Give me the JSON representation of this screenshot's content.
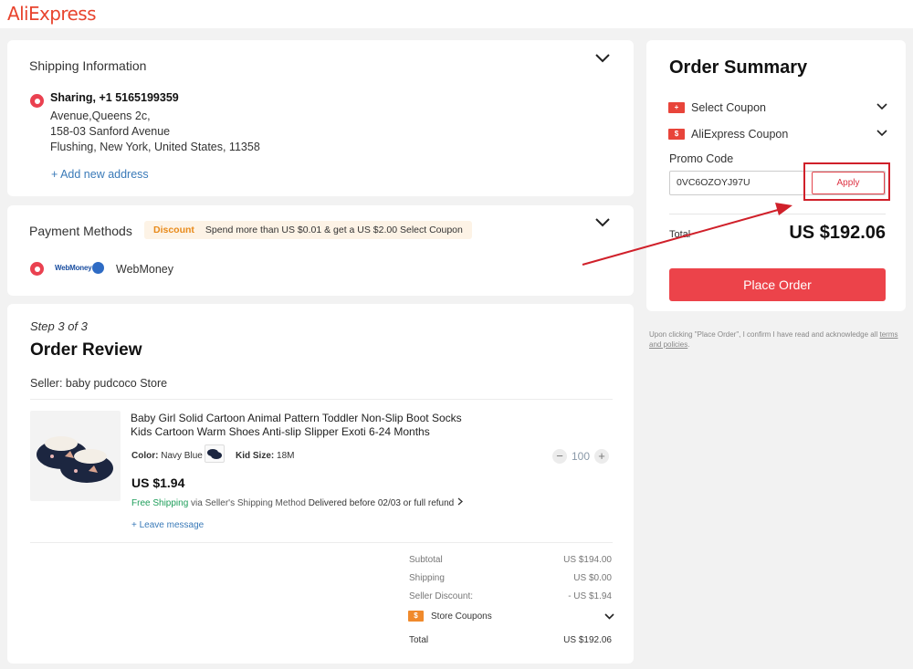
{
  "header": {
    "logo": "AliExpress"
  },
  "shipping": {
    "title": "Shipping Information",
    "name_phone": "Sharing, +1 5165199359",
    "address_lines": [
      "Avenue,Queens 2c,",
      "158-03 Sanford Avenue",
      "Flushing, New York, United States, 11358"
    ],
    "add_address": "+ Add new address"
  },
  "payment": {
    "title": "Payment Methods",
    "discount_tag": "Discount",
    "discount_text": "Spend more than US $0.01 & get a US $2.00 Select Coupon",
    "method_logo": "WebMoney",
    "method_name": "WebMoney"
  },
  "review": {
    "step": "Step 3 of 3",
    "title": "Order Review",
    "seller": "Seller: baby pudcoco Store",
    "product": {
      "title": "Baby Girl Solid Cartoon Animal Pattern Toddler Non-Slip Boot Socks Kids Cartoon Warm Shoes Anti-slip Slipper Exoti 6-24 Months",
      "color_label": "Color:",
      "color_value": "Navy Blue",
      "size_label": "Kid Size:",
      "size_value": "18M",
      "quantity": "100",
      "price": "US $1.94",
      "free_shipping": "Free Shipping",
      "shipping_method": "via Seller's Shipping Method",
      "delivery": "Delivered before 02/03 or full refund",
      "leave_message": "+ Leave message"
    },
    "summary": {
      "subtotal_label": "Subtotal",
      "subtotal_value": "US $194.00",
      "shipping_label": "Shipping",
      "shipping_value": "US $0.00",
      "seller_discount_label": "Seller Discount:",
      "seller_discount_value": "- US $1.94",
      "store_coupons_label": "Store Coupons",
      "total_label": "Total",
      "total_value": "US $192.06"
    }
  },
  "order_summary": {
    "title": "Order Summary",
    "select_coupon": "Select Coupon",
    "aliexpress_coupon": "AliExpress Coupon",
    "promo_label": "Promo Code",
    "promo_value": "0VC6OZOYJ97U",
    "apply": "Apply",
    "total_label": "Total",
    "total_value": "US $192.06",
    "place_order": "Place Order"
  },
  "disclaimer": {
    "text": "Upon clicking \"Place Order\", I confirm I have read and acknowledge all",
    "link": "terms and policies",
    "end": "."
  },
  "colors": {
    "brand": "#e8442e",
    "accent_red": "#ec434a",
    "annotation": "#d0202a",
    "link": "#3a7ab8",
    "free_shipping": "#1e9e5a"
  },
  "icons": [
    "chevron-down-icon",
    "radio-selected-icon",
    "webmoney-globe-icon",
    "coupon-icon",
    "minus-icon",
    "plus-icon",
    "chevron-right-icon",
    "annotation-arrow"
  ]
}
